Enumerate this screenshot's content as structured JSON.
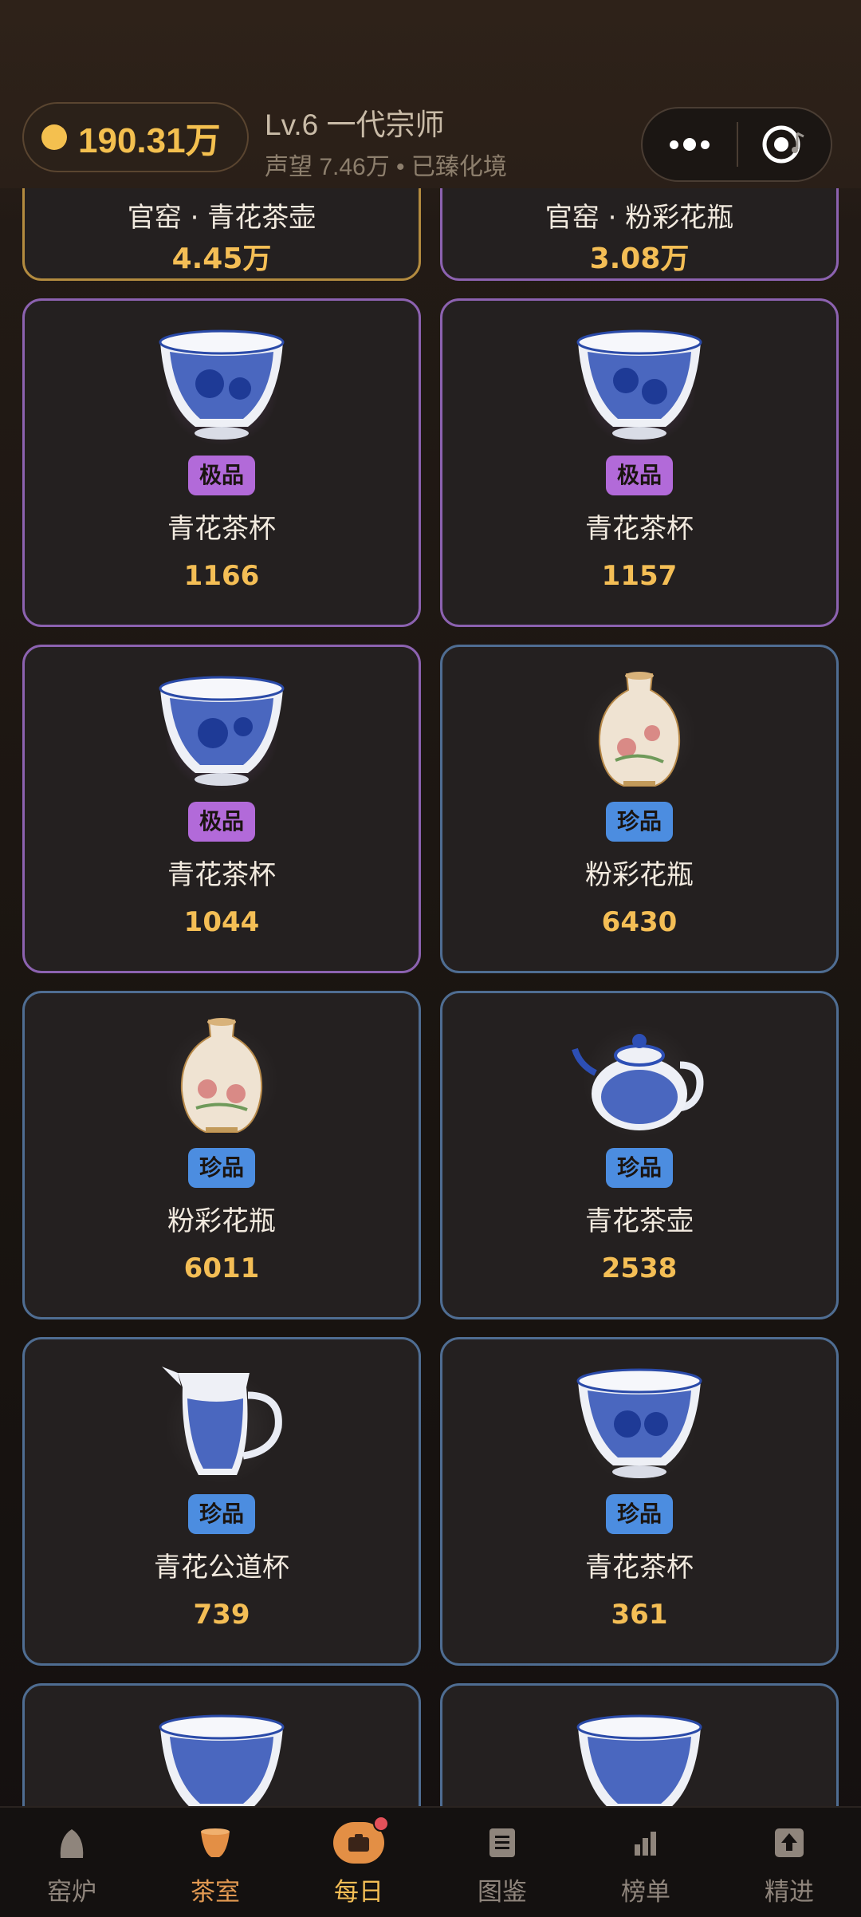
{
  "header": {
    "coins": "190.31万",
    "level": "Lv.6 一代宗师",
    "reputation": "声望 7.46万 • 已臻化境"
  },
  "top_row": [
    {
      "name": "官窑 · 青花茶壶",
      "value": "4.45万",
      "tier_color": "#b38b3f"
    },
    {
      "name": "官窑 · 粉彩花瓶",
      "value": "3.08万",
      "tier_color": "#8c62b0"
    }
  ],
  "items": [
    {
      "tier": "极品",
      "name": "青花茶杯",
      "value": "1166",
      "icon": "blue-white-teacup-icon"
    },
    {
      "tier": "极品",
      "name": "青花茶杯",
      "value": "1157",
      "icon": "blue-white-teacup-icon"
    },
    {
      "tier": "极品",
      "name": "青花茶杯",
      "value": "1044",
      "icon": "blue-white-teacup-icon"
    },
    {
      "tier": "珍品",
      "name": "粉彩花瓶",
      "value": "6430",
      "icon": "famille-rose-vase-icon"
    },
    {
      "tier": "珍品",
      "name": "粉彩花瓶",
      "value": "6011",
      "icon": "famille-rose-vase-icon"
    },
    {
      "tier": "珍品",
      "name": "青花茶壶",
      "value": "2538",
      "icon": "blue-white-teapot-icon"
    },
    {
      "tier": "珍品",
      "name": "青花公道杯",
      "value": "739",
      "icon": "blue-white-pitcher-icon"
    },
    {
      "tier": "珍品",
      "name": "青花茶杯",
      "value": "361",
      "icon": "blue-white-teacup-icon"
    }
  ],
  "nav": [
    {
      "label": "窑炉",
      "icon": "kiln-icon"
    },
    {
      "label": "茶室",
      "icon": "tea-cup-icon"
    },
    {
      "label": "每日",
      "icon": "daily-gift-icon"
    },
    {
      "label": "图鉴",
      "icon": "catalog-icon"
    },
    {
      "label": "榜单",
      "icon": "ranking-icon"
    },
    {
      "label": "精进",
      "icon": "upgrade-icon"
    }
  ]
}
